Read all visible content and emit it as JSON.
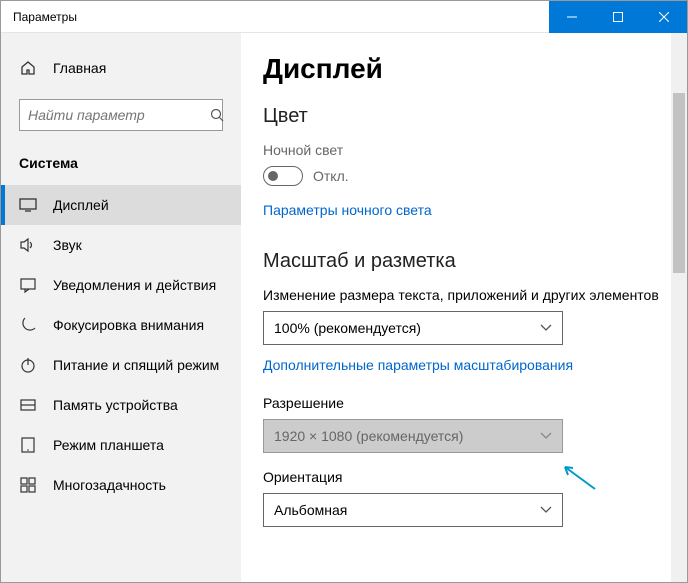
{
  "window": {
    "title": "Параметры"
  },
  "sidebar": {
    "home": "Главная",
    "search_placeholder": "Найти параметр",
    "section": "Система",
    "items": [
      {
        "label": "Дисплей"
      },
      {
        "label": "Звук"
      },
      {
        "label": "Уведомления и действия"
      },
      {
        "label": "Фокусировка внимания"
      },
      {
        "label": "Питание и спящий режим"
      },
      {
        "label": "Память устройства"
      },
      {
        "label": "Режим планшета"
      },
      {
        "label": "Многозадачность"
      }
    ]
  },
  "main": {
    "page_title": "Дисплей",
    "color_heading": "Цвет",
    "night_light_label": "Ночной свет",
    "night_light_value": "Откл.",
    "night_light_link": "Параметры ночного света",
    "scale_heading": "Масштаб и разметка",
    "scale_label": "Изменение размера текста, приложений и других элементов",
    "scale_value": "100% (рекомендуется)",
    "scale_link": "Дополнительные параметры масштабирования",
    "resolution_label": "Разрешение",
    "resolution_value": "1920 × 1080 (рекомендуется)",
    "orientation_label": "Ориентация",
    "orientation_value": "Альбомная"
  }
}
